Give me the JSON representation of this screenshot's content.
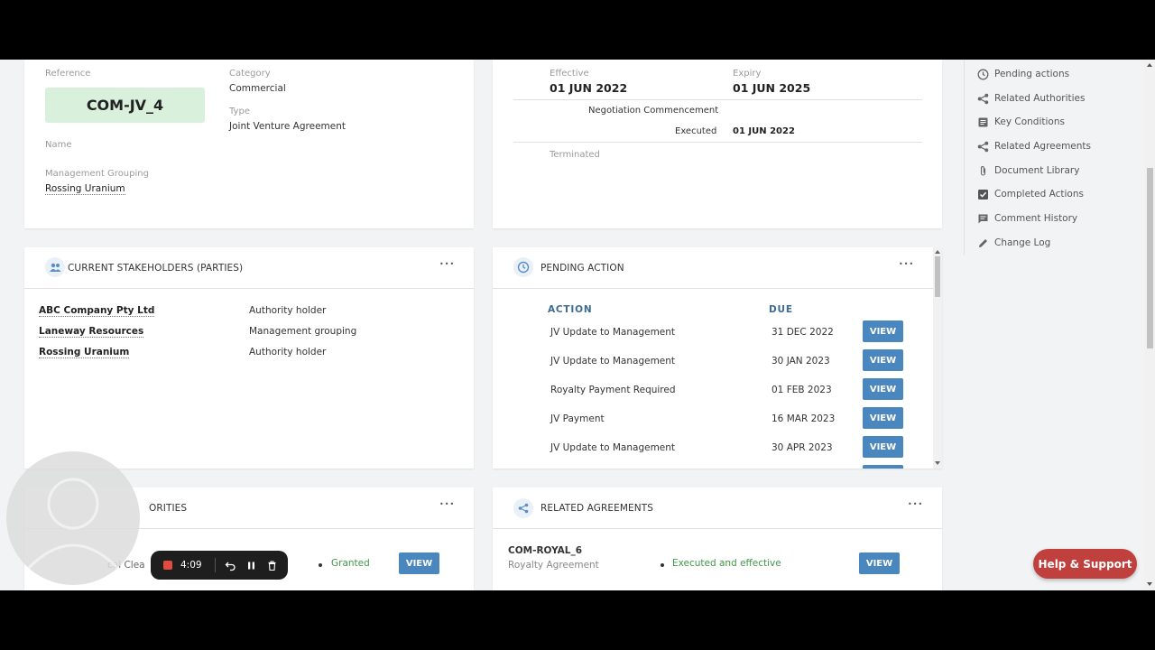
{
  "details": {
    "reference_label": "Reference",
    "reference_value": "COM-JV_4",
    "category_label": "Category",
    "category_value": "Commercial",
    "type_label": "Type",
    "type_value": "Joint Venture Agreement",
    "name_label": "Name",
    "mgmt_label": "Management Grouping",
    "mgmt_value": "Rossing Uranium"
  },
  "dates": {
    "effective_label": "Effective",
    "effective_value": "01 JUN 2022",
    "expiry_label": "Expiry",
    "expiry_value": "01 JUN 2025",
    "negotiation_label": "Negotiation Commencement",
    "executed_label": "Executed",
    "executed_value": "01 JUN 2022",
    "terminated_label": "Terminated"
  },
  "stakeholders": {
    "title": "CURRENT STAKEHOLDERS (PARTIES)",
    "menu": "•••",
    "rows": [
      {
        "name": "ABC Company Pty Ltd",
        "role": "Authority holder"
      },
      {
        "name": "Laneway Resources",
        "role": "Management grouping"
      },
      {
        "name": "Rossing Uranium",
        "role": "Authority holder"
      }
    ]
  },
  "pending": {
    "title": "PENDING ACTION",
    "menu": "•••",
    "col_action": "ACTION",
    "col_due": "DUE",
    "view_label": "VIEW",
    "rows": [
      {
        "action": "JV Update to Management",
        "due": "31 DEC 2022"
      },
      {
        "action": "JV Update to Management",
        "due": "30 JAN 2023"
      },
      {
        "action": "Royalty Payment Required",
        "due": "01 FEB 2023"
      },
      {
        "action": "JV Payment",
        "due": "16 MAR 2023"
      },
      {
        "action": "JV Update to Management",
        "due": "30 APR 2023"
      }
    ]
  },
  "authorities": {
    "title_partial": "ORITIES",
    "menu": "•••",
    "row_partial": "cal Clea",
    "status": "Granted",
    "view_label": "VIEW"
  },
  "related": {
    "title": "RELATED AGREEMENTS",
    "menu": "•••",
    "code": "COM-ROYAL_6",
    "type": "Royalty Agreement",
    "status": "Executed and effective",
    "view_label": "VIEW"
  },
  "sidebar": {
    "items": [
      {
        "label": "Pending actions",
        "icon": "clock-icon"
      },
      {
        "label": "Related Authorities",
        "icon": "share-icon"
      },
      {
        "label": "Key Conditions",
        "icon": "document-icon"
      },
      {
        "label": "Related Agreements",
        "icon": "share-icon"
      },
      {
        "label": "Document Library",
        "icon": "paperclip-icon"
      },
      {
        "label": "Completed Actions",
        "icon": "checkbox-icon"
      },
      {
        "label": "Comment History",
        "icon": "comment-icon"
      },
      {
        "label": "Change Log",
        "icon": "pencil-icon"
      }
    ]
  },
  "help": {
    "label": "Help & Support"
  },
  "recorder": {
    "time": "4:09"
  },
  "colors": {
    "accent": "#4a87bf",
    "badge": "#d8f0dc",
    "help": "#c0403d",
    "granted": "#3e9a46"
  }
}
